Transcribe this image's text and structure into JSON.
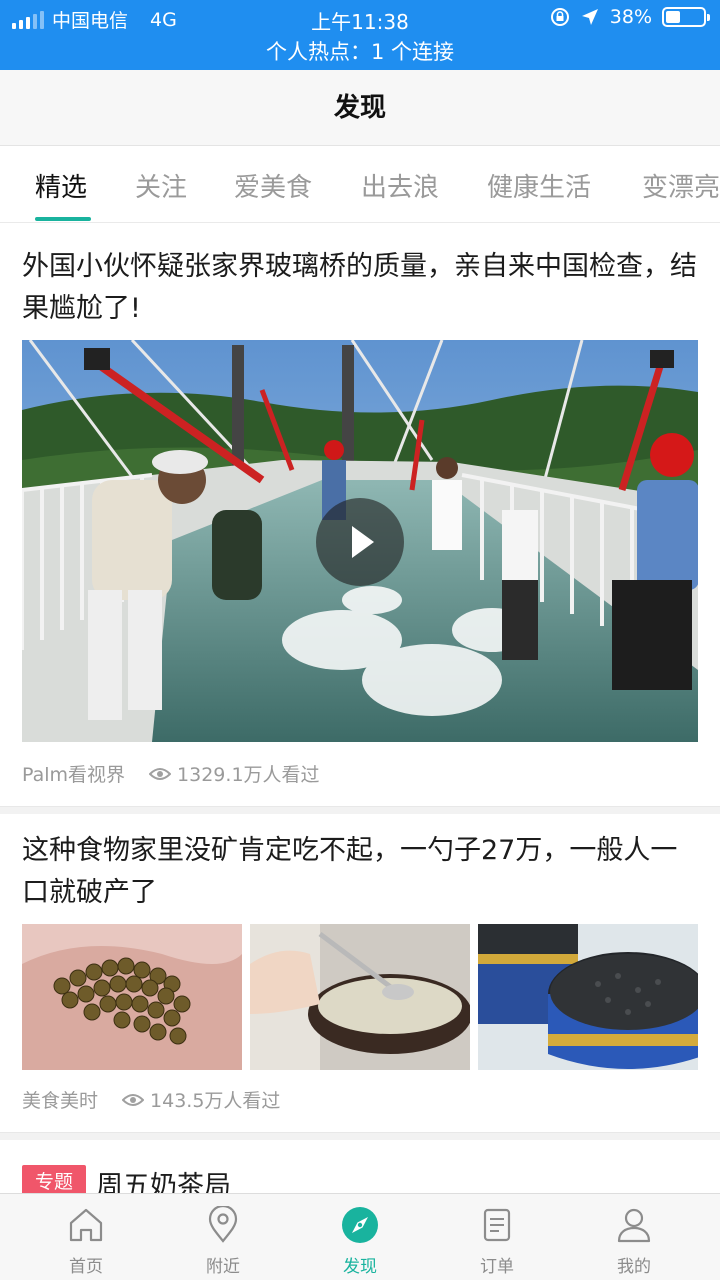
{
  "status_bar": {
    "carrier": "中国电信",
    "network": "4G",
    "time": "上午11:38",
    "battery": "38%",
    "battery_level": 0.38,
    "hotspot": "个人热点：1 个连接"
  },
  "header": {
    "title": "发现"
  },
  "tabs": [
    {
      "label": "精选",
      "active": true
    },
    {
      "label": "关注",
      "active": false
    },
    {
      "label": "爱美食",
      "active": false
    },
    {
      "label": "出去浪",
      "active": false
    },
    {
      "label": "健康生活",
      "active": false
    },
    {
      "label": "变漂亮",
      "active": false
    }
  ],
  "articles": [
    {
      "title": "外国小伙怀疑张家界玻璃桥的质量，亲自来中国检查，结果尴尬了!",
      "source": "Palm看视界",
      "views": "1329.1万人看过"
    },
    {
      "title": "这种食物家里没矿肯定吃不起，一勺子27万，一般人一口就破产了",
      "source": "美食美时",
      "views": "143.5万人看过"
    }
  ],
  "topic": {
    "badge": "专题",
    "title": "周五奶茶局"
  },
  "bottom_nav": [
    {
      "label": "首页",
      "icon": "home-icon"
    },
    {
      "label": "附近",
      "icon": "location-pin-icon"
    },
    {
      "label": "发现",
      "icon": "compass-icon",
      "active": true
    },
    {
      "label": "订单",
      "icon": "order-list-icon"
    },
    {
      "label": "我的",
      "icon": "profile-icon"
    }
  ],
  "colors": {
    "status_bar": "#1f8ef0",
    "accent": "#19b39e",
    "topic_badge": "#f0566a"
  }
}
